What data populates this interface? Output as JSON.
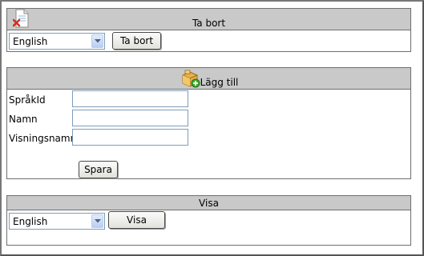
{
  "delete_panel": {
    "title": "Ta bort",
    "icon": "delete-document-icon",
    "language_select": {
      "selected": "English"
    },
    "button_label": "Ta bort"
  },
  "add_panel": {
    "title": "Lägg till",
    "icon": "add-package-icon",
    "fields": [
      {
        "label": "SpråkId",
        "value": ""
      },
      {
        "label": "Namn",
        "value": ""
      },
      {
        "label": "Visningsnamn",
        "value": ""
      }
    ],
    "save_label": "Spara"
  },
  "show_panel": {
    "title": "Visa",
    "language_select": {
      "selected": "English"
    },
    "button_label": "Visa"
  },
  "colors": {
    "header_bg": "#c9c9c9",
    "border": "#6f6f6f",
    "input_border": "#7f9db9"
  }
}
